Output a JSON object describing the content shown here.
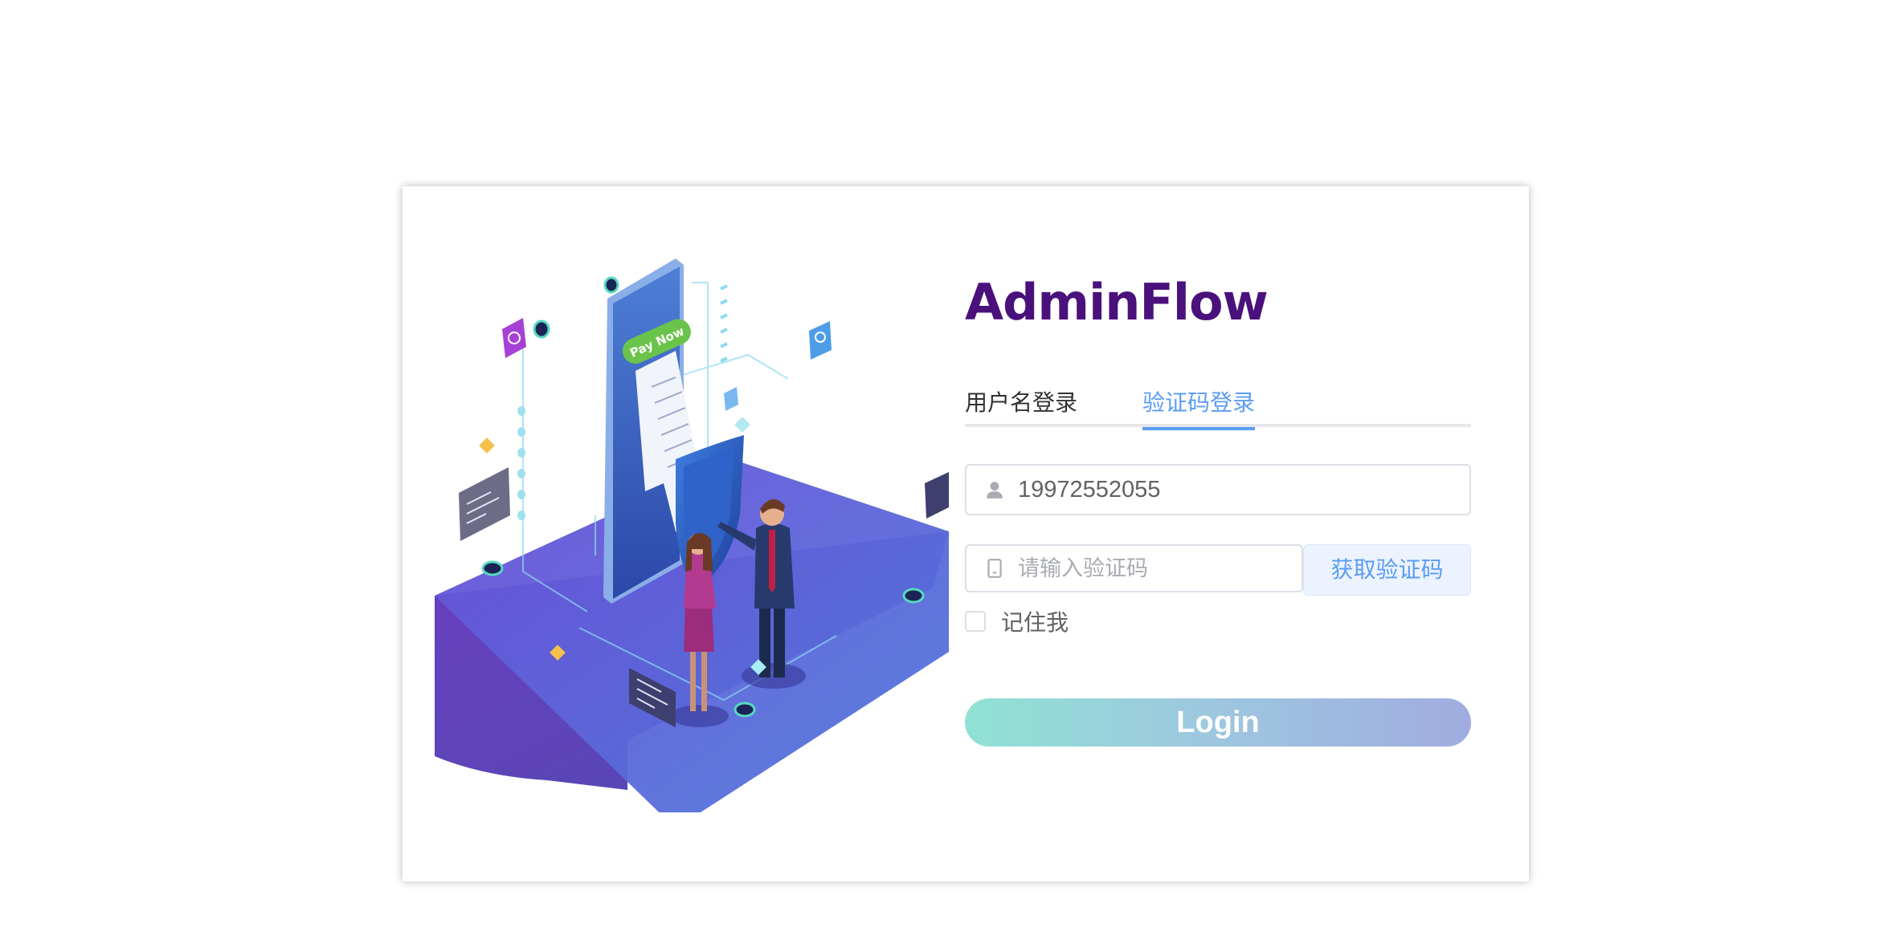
{
  "brand": {
    "title": "AdminFlow",
    "color": "#4a117c"
  },
  "tabs": [
    {
      "label": "用户名登录",
      "active": false
    },
    {
      "label": "验证码登录",
      "active": true
    }
  ],
  "phone_field": {
    "value": "19972552055",
    "icon": "user-icon"
  },
  "code_field": {
    "value": "",
    "placeholder": "请输入验证码",
    "icon": "phone-icon"
  },
  "get_code_button": {
    "label": "获取验证码"
  },
  "remember": {
    "label": "记住我",
    "checked": false
  },
  "login_button": {
    "label": "Login"
  },
  "illustration": {
    "badge_text": "Pay Now"
  },
  "colors": {
    "accent": "#5b9cf3",
    "brand": "#4a117c",
    "login_gradient_start": "#90e2d4",
    "login_gradient_end": "#a0ace0"
  }
}
